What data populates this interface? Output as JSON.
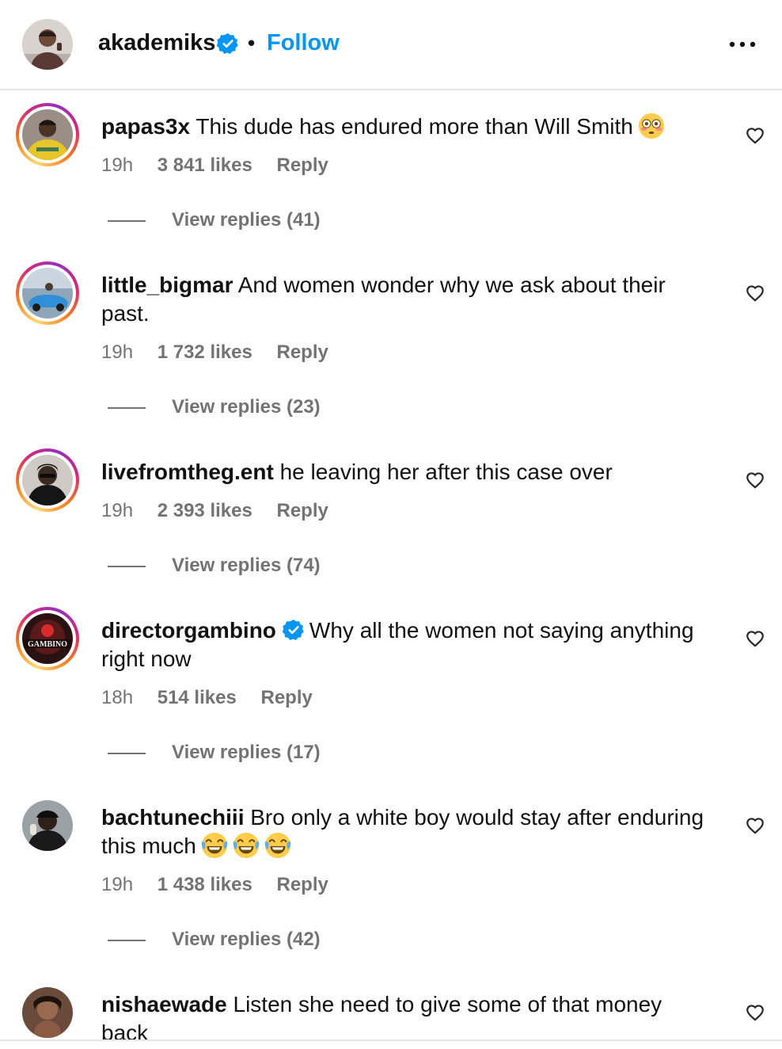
{
  "post_header": {
    "username": "akademiks",
    "separator": "•",
    "follow_label": "Follow",
    "verified": true,
    "more_icon": "more-horizontal-icon"
  },
  "colors": {
    "follow_blue": "#0095f6",
    "verified_blue": "#0095f6",
    "meta_gray": "#737373",
    "divider": "#e4e4e4"
  },
  "comments": [
    {
      "username": "papas3x",
      "verified": false,
      "text": "This dude has endured more than Will Smith",
      "emoji": [
        "flushed-face-emoji"
      ],
      "time": "19h",
      "likes": "3 841 likes",
      "reply_label": "Reply",
      "view_replies": "View replies (41)",
      "story_ring": true
    },
    {
      "username": "little_bigmar",
      "verified": false,
      "text": "And women wonder why we ask about their past.",
      "time": "19h",
      "likes": "1 732 likes",
      "reply_label": "Reply",
      "view_replies": "View replies (23)",
      "story_ring": true
    },
    {
      "username": "livefromtheg.ent",
      "verified": false,
      "text": "he leaving her after this case over",
      "time": "19h",
      "likes": "2 393 likes",
      "reply_label": "Reply",
      "view_replies": "View replies (74)",
      "story_ring": true
    },
    {
      "username": "directorgambino",
      "verified": true,
      "text": "Why all the women not saying anything right now",
      "avatar_text": "GAMBINO",
      "time": "18h",
      "likes": "514 likes",
      "reply_label": "Reply",
      "view_replies": "View replies (17)",
      "story_ring": true
    },
    {
      "username": "bachtunechiii",
      "verified": false,
      "text": "Bro only a white boy would stay after enduring this much",
      "emoji": [
        "tears-of-joy-emoji",
        "tears-of-joy-emoji",
        "tears-of-joy-emoji"
      ],
      "time": "19h",
      "likes": "1 438 likes",
      "reply_label": "Reply",
      "view_replies": "View replies (42)",
      "story_ring": false
    },
    {
      "username": "nishaewade",
      "verified": false,
      "text": "Listen she need to give some of that money back",
      "story_ring": false
    }
  ]
}
